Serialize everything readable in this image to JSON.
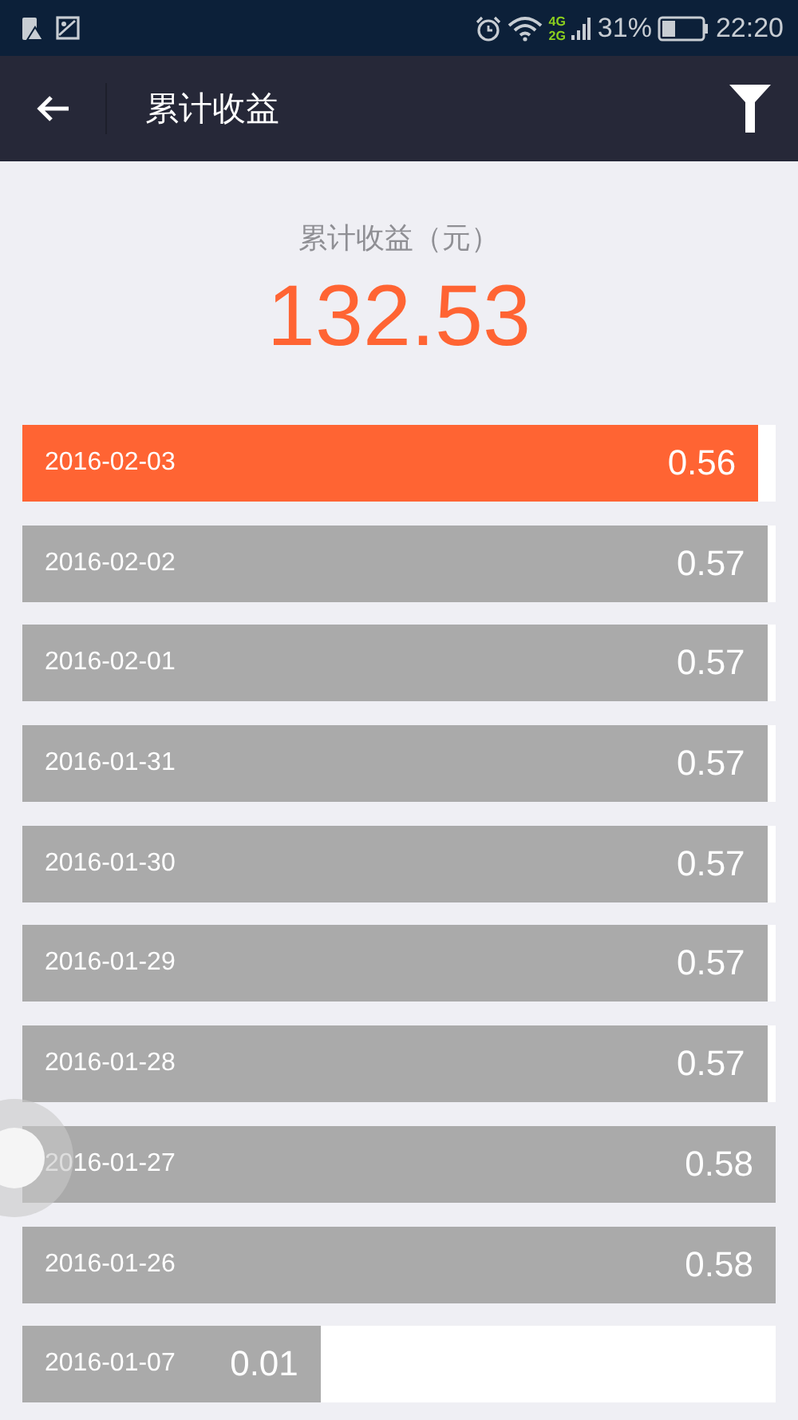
{
  "status_bar": {
    "network_top": "4G",
    "network_bottom": "2G",
    "battery": "31%",
    "time": "22:20"
  },
  "header": {
    "title": "累计收益"
  },
  "summary": {
    "label": "累计收益（元）",
    "amount": "132.53"
  },
  "rows": [
    {
      "date": "2016-02-03",
      "amount": "0.56",
      "level": 0.977,
      "selected": true
    },
    {
      "date": "2016-02-02",
      "amount": "0.57",
      "level": 0.989,
      "selected": false
    },
    {
      "date": "2016-02-01",
      "amount": "0.57",
      "level": 0.989,
      "selected": false
    },
    {
      "date": "2016-01-31",
      "amount": "0.57",
      "level": 0.989,
      "selected": false
    },
    {
      "date": "2016-01-30",
      "amount": "0.57",
      "level": 0.989,
      "selected": false
    },
    {
      "date": "2016-01-29",
      "amount": "0.57",
      "level": 0.989,
      "selected": false
    },
    {
      "date": "2016-01-28",
      "amount": "0.57",
      "level": 0.989,
      "selected": false
    },
    {
      "date": "2016-01-27",
      "amount": "0.58",
      "level": 1.0,
      "selected": false
    },
    {
      "date": "2016-01-26",
      "amount": "0.58",
      "level": 1.0,
      "selected": false
    },
    {
      "date": "2016-01-07",
      "amount": "0.01",
      "level": 0.396,
      "selected": false
    }
  ]
}
